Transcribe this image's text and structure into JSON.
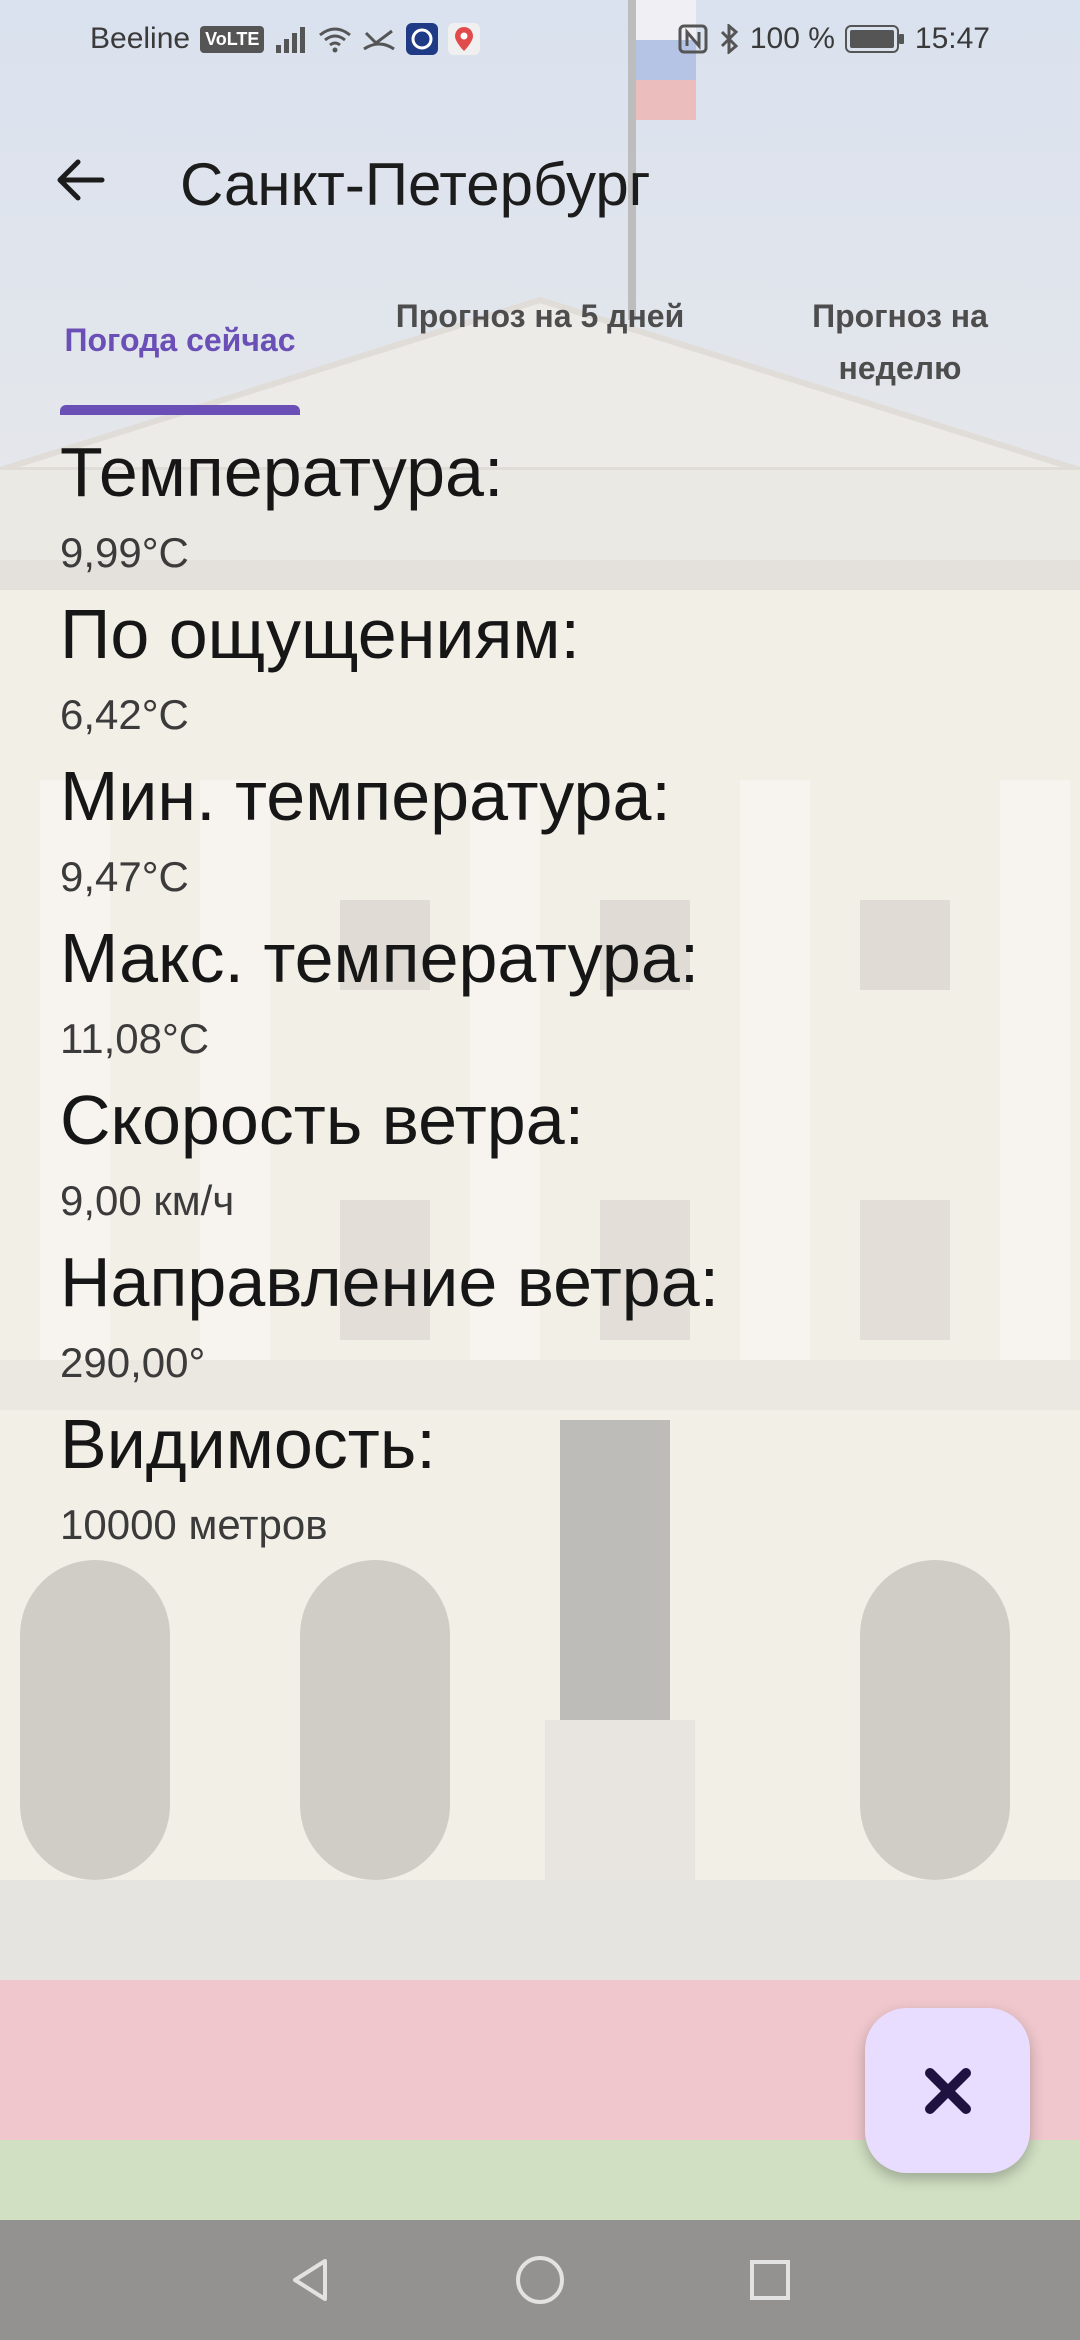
{
  "status_bar": {
    "carrier": "Beeline",
    "volte": "VoLTE",
    "battery": "100 %",
    "time": "15:47"
  },
  "app_bar": {
    "title": "Санкт-Петербург",
    "back_icon": "arrow-left-icon"
  },
  "tabs": [
    {
      "label": "Погода сейчас",
      "selected": true
    },
    {
      "label": "Прогноз на 5 дней",
      "selected": false
    },
    {
      "label": "Прогноз на неделю",
      "selected": false
    }
  ],
  "weather": [
    {
      "label": "Температура:",
      "value": "9,99°C"
    },
    {
      "label": "По ощущениям:",
      "value": "6,42°C"
    },
    {
      "label": "Мин. температура:",
      "value": "9,47°C"
    },
    {
      "label": "Макс. температура:",
      "value": "11,08°C"
    },
    {
      "label": "Скорость ветра:",
      "value": "9,00 км/ч"
    },
    {
      "label": "Направление ветра:",
      "value": "290,00°"
    },
    {
      "label": "Видимость:",
      "value": "10000 метров"
    }
  ],
  "fab": {
    "icon": "close-icon"
  },
  "colors": {
    "accent": "#6a4fb7",
    "fab_bg": "#e9ddff"
  }
}
